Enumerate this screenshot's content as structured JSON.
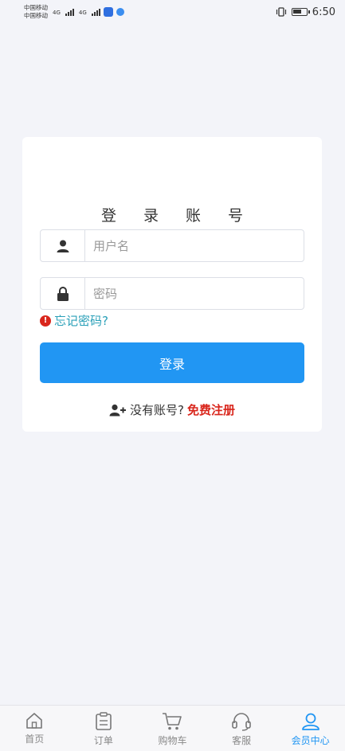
{
  "status_bar": {
    "carrier_1": "中国移动",
    "carrier_2": "中国移动",
    "net_1": "4G",
    "net_2": "4G",
    "time": "6:50"
  },
  "login": {
    "title": "登 录 账 号",
    "username_placeholder": "用户名",
    "password_placeholder": "密码",
    "forgot_label": "忘记密码?",
    "login_button": "登录",
    "no_account_text": "没有账号?",
    "register_link": "免费注册"
  },
  "tabbar": {
    "items": [
      {
        "label": "首页",
        "icon": "home-icon"
      },
      {
        "label": "订单",
        "icon": "order-icon"
      },
      {
        "label": "购物车",
        "icon": "cart-icon"
      },
      {
        "label": "客服",
        "icon": "headset-icon"
      },
      {
        "label": "会员中心",
        "icon": "user-icon"
      }
    ],
    "active_index": 4
  },
  "colors": {
    "primary": "#2196f3",
    "accent_red": "#d9261c",
    "link_teal": "#2aa0b8",
    "background": "#f3f4f9"
  }
}
